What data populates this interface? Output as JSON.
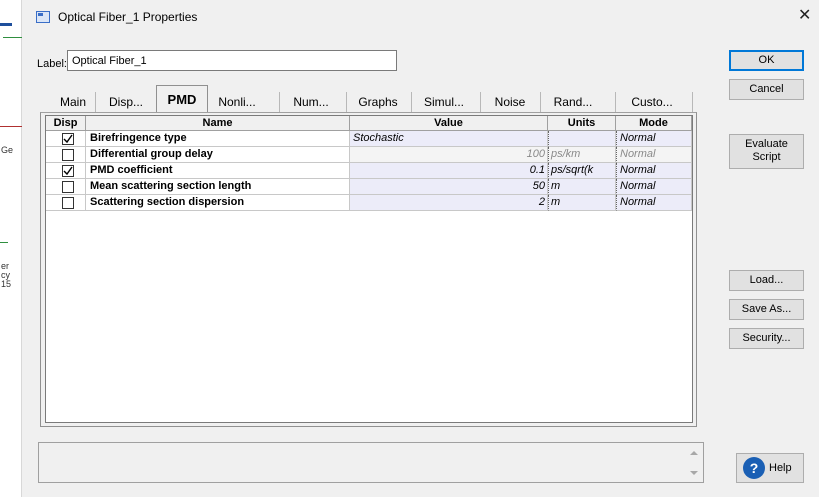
{
  "window": {
    "title": "Optical Fiber_1 Properties"
  },
  "label_field": {
    "caption": "Label:",
    "value": "Optical Fiber_1"
  },
  "buttons": {
    "ok": "OK",
    "cancel": "Cancel",
    "evaluate_line1": "Evaluate",
    "evaluate_line2": "Script",
    "load": "Load...",
    "save_as": "Save As...",
    "security": "Security...",
    "help": "Help"
  },
  "tabs": [
    {
      "label": "Main"
    },
    {
      "label": "Disp..."
    },
    {
      "label": "PMD",
      "active": true
    },
    {
      "label": "Nonli..."
    },
    {
      "label": "Num..."
    },
    {
      "label": "Graphs"
    },
    {
      "label": "Simul..."
    },
    {
      "label": "Noise"
    },
    {
      "label": "Rand..."
    },
    {
      "label": "Custo..."
    }
  ],
  "grid": {
    "columns": [
      "Disp",
      "Name",
      "Value",
      "Units",
      "Mode"
    ],
    "rows": [
      {
        "disp": true,
        "name": "Birefringence type",
        "value": "Stochastic",
        "units": "",
        "mode": "Normal",
        "disabled": false,
        "align": "left"
      },
      {
        "disp": false,
        "name": "Differential group delay",
        "value": "100",
        "units": "ps/km",
        "mode": "Normal",
        "disabled": true,
        "align": "right"
      },
      {
        "disp": true,
        "name": "PMD coefficient",
        "value": "0.1",
        "units": "ps/sqrt(k",
        "mode": "Normal",
        "disabled": false,
        "align": "right"
      },
      {
        "disp": false,
        "name": "Mean scattering section length",
        "value": "50",
        "units": "m",
        "mode": "Normal",
        "disabled": false,
        "align": "right"
      },
      {
        "disp": false,
        "name": "Scattering section dispersion",
        "value": "2",
        "units": "m",
        "mode": "Normal",
        "disabled": false,
        "align": "right"
      }
    ]
  },
  "background": {
    "fragments": [
      "Ge",
      "er",
      "cy",
      "15"
    ]
  },
  "icons": {
    "checkmark": "check-icon",
    "help": "help-icon",
    "close": "close-icon"
  },
  "colors": {
    "ok_border": "#0078d7",
    "editable_cell": "#ececf9",
    "help_blue": "#1a5fb4"
  }
}
